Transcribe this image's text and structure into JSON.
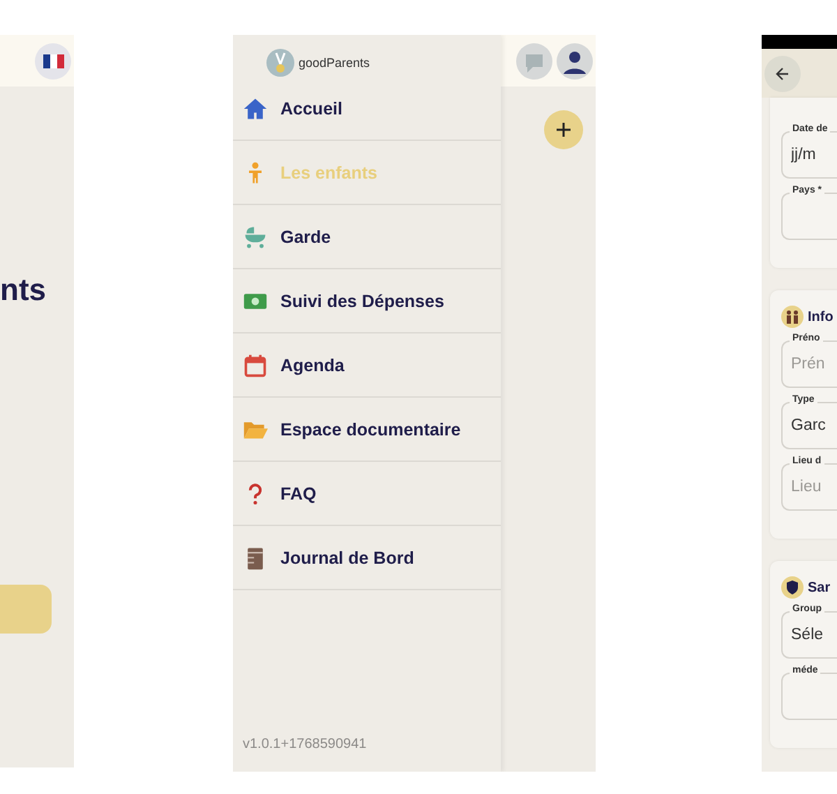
{
  "welcome": {
    "title": "nts"
  },
  "drawer": {
    "brand": "goodParents",
    "items": [
      {
        "label": "Accueil",
        "selected": false
      },
      {
        "label": "Les enfants",
        "selected": true
      },
      {
        "label": "Garde",
        "selected": false
      },
      {
        "label": "Suivi des Dépenses",
        "selected": false
      },
      {
        "label": "Agenda",
        "selected": false
      },
      {
        "label": "Espace documentaire",
        "selected": false
      },
      {
        "label": "FAQ",
        "selected": false
      },
      {
        "label": "Journal de Bord",
        "selected": false
      }
    ],
    "version": "v1.0.1+1768590941"
  },
  "form": {
    "sections": [
      {
        "fields": [
          {
            "label": "Date de",
            "value": "jj/m"
          },
          {
            "label": "Pays *"
          }
        ]
      },
      {
        "title": "Info",
        "fields": [
          {
            "label": "Préno",
            "placeholder": "Prén"
          },
          {
            "label": "Type",
            "value": "Garc"
          },
          {
            "label": "Lieu d",
            "placeholder": "Lieu"
          }
        ]
      },
      {
        "title": "Sar",
        "fields": [
          {
            "label": "Group",
            "value": "Séle"
          },
          {
            "label": "méde"
          }
        ]
      }
    ]
  }
}
